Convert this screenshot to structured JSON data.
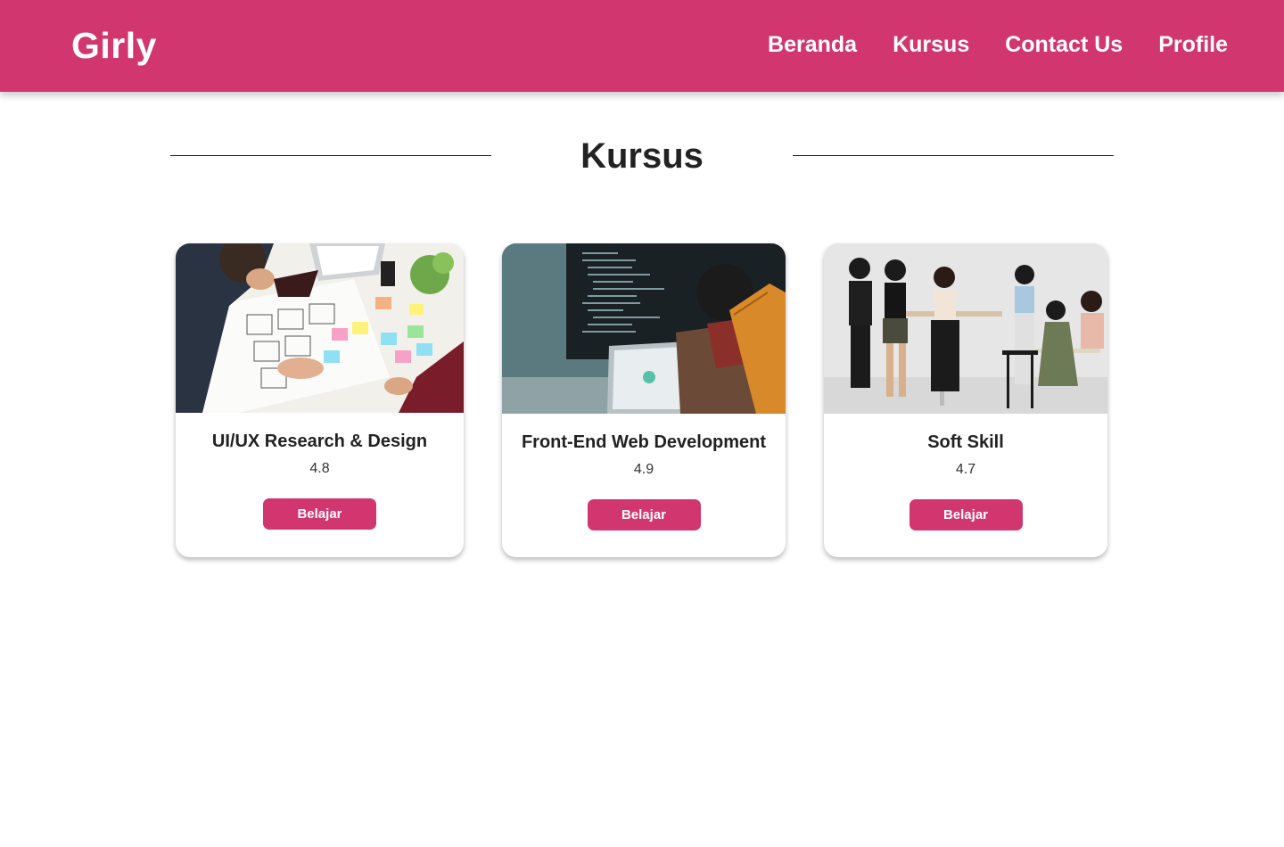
{
  "navbar": {
    "brand": "Girly",
    "links": [
      {
        "label": "Beranda"
      },
      {
        "label": "Kursus"
      },
      {
        "label": "Contact Us"
      },
      {
        "label": "Profile"
      }
    ],
    "background_color": "#d1366e"
  },
  "section": {
    "title": "Kursus"
  },
  "courses": [
    {
      "title": "UI/UX Research & Design",
      "rating": "4.8",
      "button": "Belajar",
      "image": "ux-design-workshop-photo"
    },
    {
      "title": "Front-End Web Development",
      "rating": "4.9",
      "button": "Belajar",
      "image": "developer-coding-photo"
    },
    {
      "title": "Soft Skill",
      "rating": "4.7",
      "button": "Belajar",
      "image": "team-meeting-photo"
    }
  ],
  "colors": {
    "accent": "#d1366e",
    "text": "#222222",
    "background": "#ffffff"
  }
}
